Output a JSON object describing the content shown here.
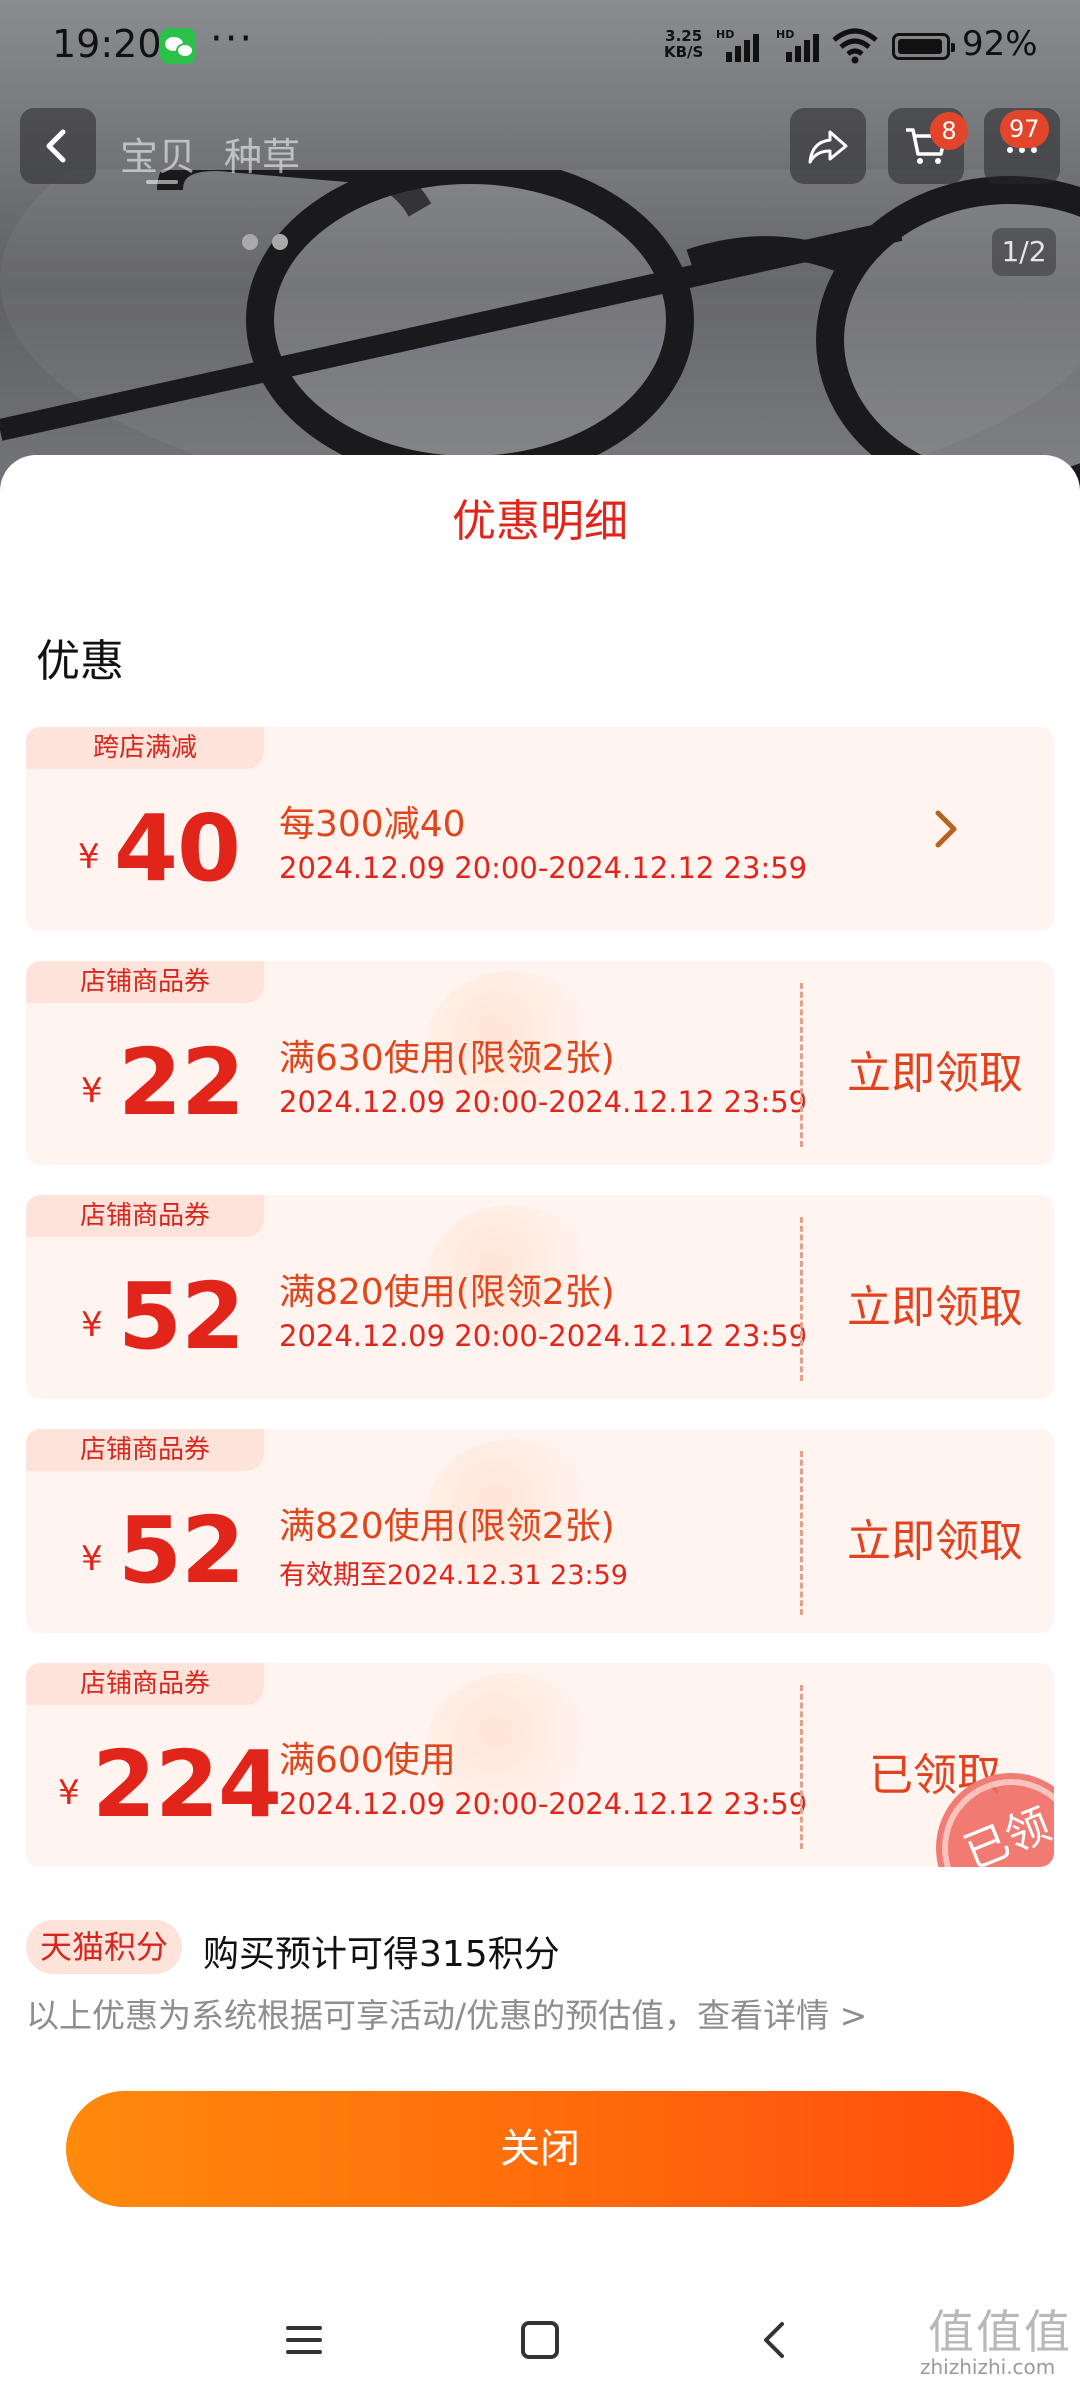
{
  "status_bar": {
    "time": "19:20",
    "more": "···",
    "net_speed_value": "3.25",
    "net_speed_unit": "KB/S",
    "hd_label": "HD",
    "battery": "92%"
  },
  "top_nav": {
    "tabs": [
      "宝贝",
      "种草"
    ],
    "cart_badge": "8",
    "message_badge": "97",
    "image_counter": "1/2"
  },
  "sheet": {
    "title": "优惠明细",
    "section_title": "优惠",
    "coupons": [
      {
        "tag": "跨店满减",
        "currency": "¥",
        "amount": "40",
        "condition": "每300减40",
        "validity": "2024.12.09 20:00-2024.12.12 23:59",
        "action": ""
      },
      {
        "tag": "店铺商品券",
        "currency": "¥",
        "amount": "22",
        "condition": "满630使用(限领2张)",
        "validity": "2024.12.09 20:00-2024.12.12 23:59",
        "action": "立即领取"
      },
      {
        "tag": "店铺商品券",
        "currency": "¥",
        "amount": "52",
        "condition": "满820使用(限领2张)",
        "validity": "2024.12.09 20:00-2024.12.12 23:59",
        "action": "立即领取"
      },
      {
        "tag": "店铺商品券",
        "currency": "¥",
        "amount": "52",
        "condition": "满820使用(限领2张)",
        "validity": "有效期至2024.12.31 23:59",
        "action": "立即领取"
      },
      {
        "tag": "店铺商品券",
        "currency": "¥",
        "amount": "224",
        "condition": "满600使用",
        "validity": "2024.12.09 20:00-2024.12.12 23:59",
        "action": "已领取",
        "stamp": "已领"
      }
    ],
    "points_tag": "天猫积分",
    "points_text": "购买预计可得315积分",
    "note": "以上优惠为系统根据可享活动/优惠的预估值，查看详情 >",
    "close_button": "关闭"
  },
  "watermark": {
    "logo": "值值值",
    "site": "zhizhizhi.com"
  },
  "colors": {
    "accent_red": "#e1251b",
    "accent_orange": "#ff6a0b",
    "coupon_bg": "#fff4ef"
  },
  "icons": [
    "back-arrow-icon",
    "share-icon",
    "cart-icon",
    "message-icon",
    "chevron-right-icon",
    "menu-icon",
    "home-icon",
    "back-icon"
  ]
}
